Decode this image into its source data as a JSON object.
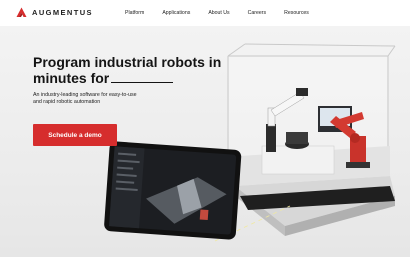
{
  "brand": {
    "name": "AUGMENTUS",
    "logo_icon": "augmentus-logo-icon",
    "accent_color": "#d62d2d"
  },
  "nav": {
    "items": [
      {
        "label": "Platform"
      },
      {
        "label": "Applications"
      },
      {
        "label": "About Us"
      },
      {
        "label": "Careers"
      },
      {
        "label": "Resources"
      }
    ]
  },
  "hero": {
    "headline_line1": "Program industrial robots in",
    "headline_line2": "minutes for",
    "subtitle": "An industry-leading software for easy-to-use and rapid robotic automation",
    "cta_label": "Schedule a demo"
  }
}
